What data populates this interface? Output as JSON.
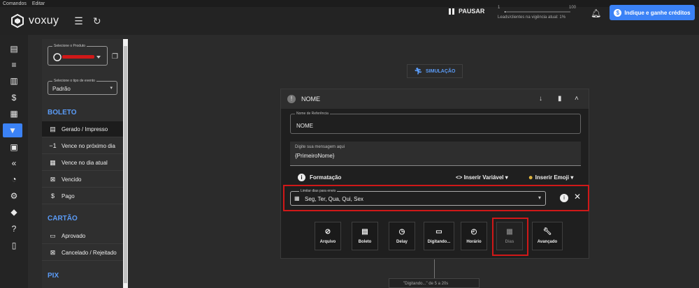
{
  "menubar": {
    "items": [
      "Comandos",
      "Editar"
    ]
  },
  "topbar": {
    "logo_text": "voxuy",
    "pause_label": "PAUSAR",
    "progress": {
      "min": "1",
      "max": "100",
      "fraction": 0.01,
      "caption": "Leads/clientes na vigência atual: 1%"
    },
    "refer_label": "Indique e ganhe créditos",
    "accent": "#3b82f6"
  },
  "rail": {
    "icons": [
      "chat-icon",
      "list-icon",
      "report-icon",
      "dollar-icon",
      "feedback-icon",
      "funnel-icon",
      "store-icon",
      "reply-all-icon",
      "speed-icon",
      "gear-icon",
      "tag-icon",
      "help-icon",
      "book-icon"
    ],
    "active_index": 5
  },
  "panel": {
    "product_legend": "Selecione o Produto",
    "event_legend": "Selecione o tipo de evento",
    "event_value": "Padrão",
    "sections": [
      {
        "title": "BOLETO",
        "items": [
          {
            "label": "Gerado / Impresso",
            "icon": "receipt-icon",
            "active": true
          },
          {
            "label": "Vence no próximo dia",
            "icon": "minus-one-icon"
          },
          {
            "label": "Vence no dia atual",
            "icon": "calendar-icon"
          },
          {
            "label": "Vencido",
            "icon": "x-box-icon"
          },
          {
            "label": "Pago",
            "icon": "dollar-icon"
          }
        ]
      },
      {
        "title": "CARTÃO",
        "items": [
          {
            "label": "Aprovado",
            "icon": "card-icon"
          },
          {
            "label": "Cancelado / Rejeitado",
            "icon": "x-box-icon"
          }
        ]
      },
      {
        "title": "PIX",
        "items": []
      }
    ]
  },
  "canvas": {
    "simulation_label": "SIMULAÇÃO",
    "card": {
      "title": "NOME",
      "ref_legend": "Nome de Referência",
      "ref_value": "NOME",
      "message_label": "Digite sua mensagem aqui",
      "message_value": "{PrimeiroNome}",
      "format_label": "Formatação",
      "insert_variable_label": "Inserir Variável",
      "insert_emoji_label": "Inserir Emoji",
      "days_legend": "Limitar dias para envio",
      "days_value": "Seg, Ter, Qua, Qui, Sex",
      "tools": [
        {
          "label": "Arquivo",
          "icon": "paperclip-icon"
        },
        {
          "label": "Boleto",
          "icon": "receipt-icon"
        },
        {
          "label": "Delay",
          "icon": "timer-icon"
        },
        {
          "label": "Digitando...",
          "icon": "typing-icon"
        },
        {
          "label": "Horário",
          "icon": "clock-icon"
        },
        {
          "label": "Dias",
          "icon": "calendar-icon",
          "disabled": true
        },
        {
          "label": "Avançado",
          "icon": "wrench-icon"
        }
      ]
    },
    "next_node_text": "\"Digitando...\" de 5 a 20s"
  }
}
